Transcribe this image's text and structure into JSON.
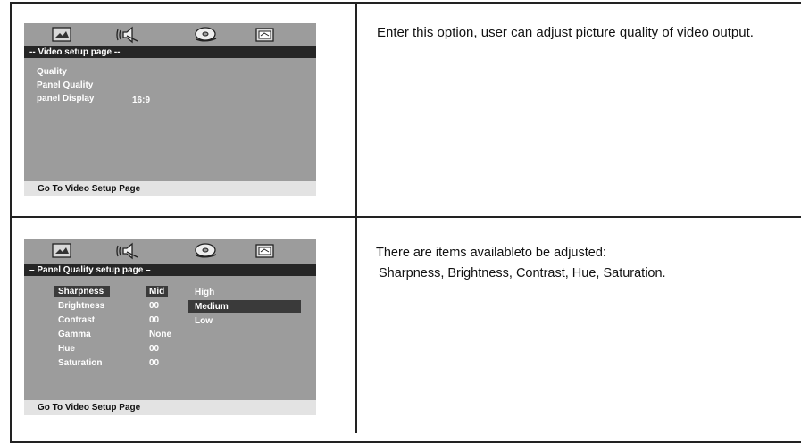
{
  "row1": {
    "menu_title": "-- Video setup page --",
    "items": [
      {
        "label": "Quality",
        "value": ""
      },
      {
        "label": "Panel Quality",
        "value": ""
      },
      {
        "label": "panel Display",
        "value": "16:9"
      }
    ],
    "footer": "Go To Video Setup Page",
    "description": "Enter this option, user can adjust picture quality of video output."
  },
  "row2": {
    "menu_title": "– Panel Quality setup page –",
    "items": [
      {
        "label": "Sharpness",
        "value": "Mid"
      },
      {
        "label": "Brightness",
        "value": "00"
      },
      {
        "label": "Contrast",
        "value": "00"
      },
      {
        "label": "Gamma",
        "value": "None"
      },
      {
        "label": "Hue",
        "value": "00"
      },
      {
        "label": "Saturation",
        "value": "00"
      }
    ],
    "options": [
      "High",
      "Medium",
      "Low"
    ],
    "selected_option": "Medium",
    "footer": "Go To Video Setup Page",
    "description_line1": "There are items availableto be adjusted:",
    "description_line2": "Sharpness, Brightness, Contrast, Hue, Saturation."
  },
  "icons": [
    "picture-icon",
    "audio-icon",
    "disc-icon",
    "preferences-icon"
  ]
}
